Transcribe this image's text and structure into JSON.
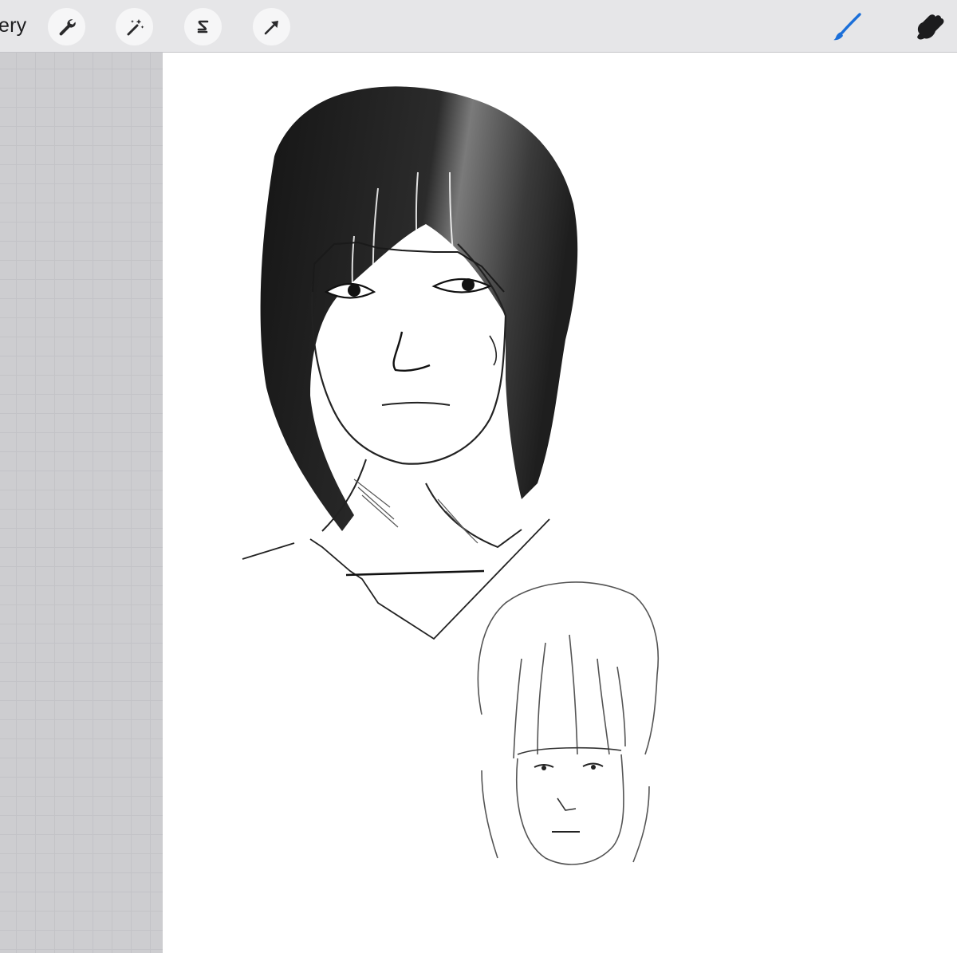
{
  "toolbar": {
    "gallery_label": "ery",
    "tools": [
      "wrench-icon",
      "magic-wand-icon",
      "selection-s-icon",
      "transform-arrow-icon"
    ],
    "right_tools": [
      "brush-icon",
      "smudge-icon"
    ],
    "accent": "#1b6fd9"
  },
  "canvas": {
    "background": "#ffffff",
    "sketches": [
      "large-portrait-sketch",
      "small-portrait-sketch"
    ]
  }
}
